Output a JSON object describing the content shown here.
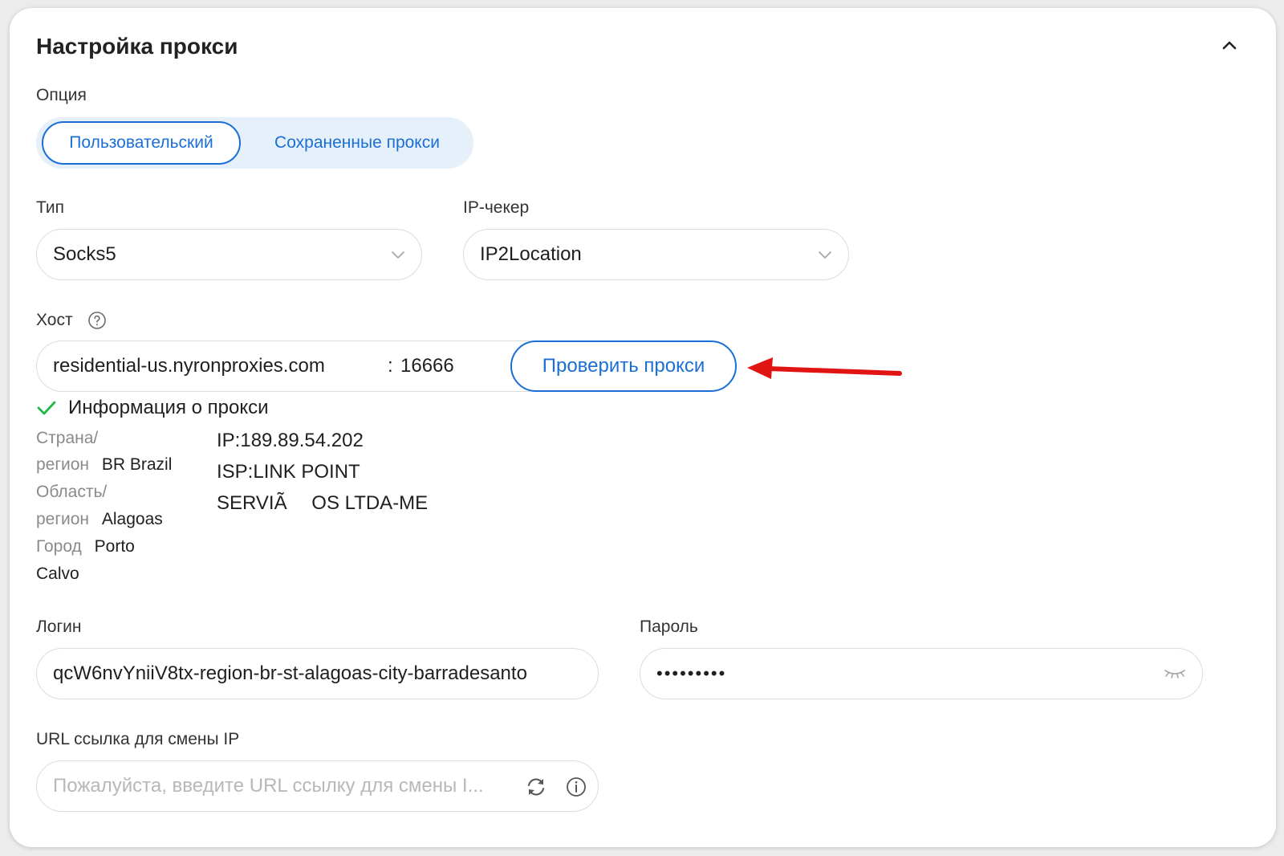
{
  "panel": {
    "title": "Настройка прокси"
  },
  "option": {
    "label": "Опция",
    "tabs": [
      {
        "label": "Пользовательский",
        "active": true
      },
      {
        "label": "Сохраненные прокси",
        "active": false
      }
    ]
  },
  "type": {
    "label": "Тип",
    "value": "Socks5"
  },
  "ip_checker": {
    "label": "IP-чекер",
    "value": "IP2Location"
  },
  "host": {
    "label": "Хост",
    "value": "residential-us.nyronproxies.com",
    "port_prefix": ":",
    "port": "16666",
    "check_button": "Проверить прокси"
  },
  "proxy_info": {
    "heading": "Информация о прокси",
    "country_key_1": "Страна/",
    "country_key_2": "регион",
    "country_value": "BR Brazil",
    "region_key_1": "Область/",
    "region_key_2": "регион",
    "region_value": "Alagoas",
    "city_key": "Город",
    "city_value_1": "Porto",
    "city_value_2": "Calvo",
    "ip": "IP:189.89.54.202",
    "isp_1": "ISP:LINK POINT",
    "isp_2": "SERVIÃ",
    "isp_3": "OS LTDA-ME"
  },
  "login": {
    "label": "Логин",
    "value": "qcW6nvYniiV8tx-region-br-st-alagoas-city-barradesanto"
  },
  "password": {
    "label": "Пароль",
    "value": "•••••••••"
  },
  "change_ip_url": {
    "label": "URL ссылка для смены IP",
    "placeholder": "Пожалуйста, введите URL ссылку для смены I..."
  },
  "colors": {
    "accent": "#1a6fd6",
    "success": "#1fb84a",
    "annotation_arrow": "#e11414"
  },
  "icons": {
    "collapse": "chevron-up-icon",
    "dropdown": "chevron-down-icon",
    "help": "question-circle-icon",
    "success": "check-icon",
    "password_toggle": "eye-closed-icon",
    "refresh": "refresh-icon",
    "info": "info-circle-icon",
    "annotation": "red-arrow-icon"
  }
}
